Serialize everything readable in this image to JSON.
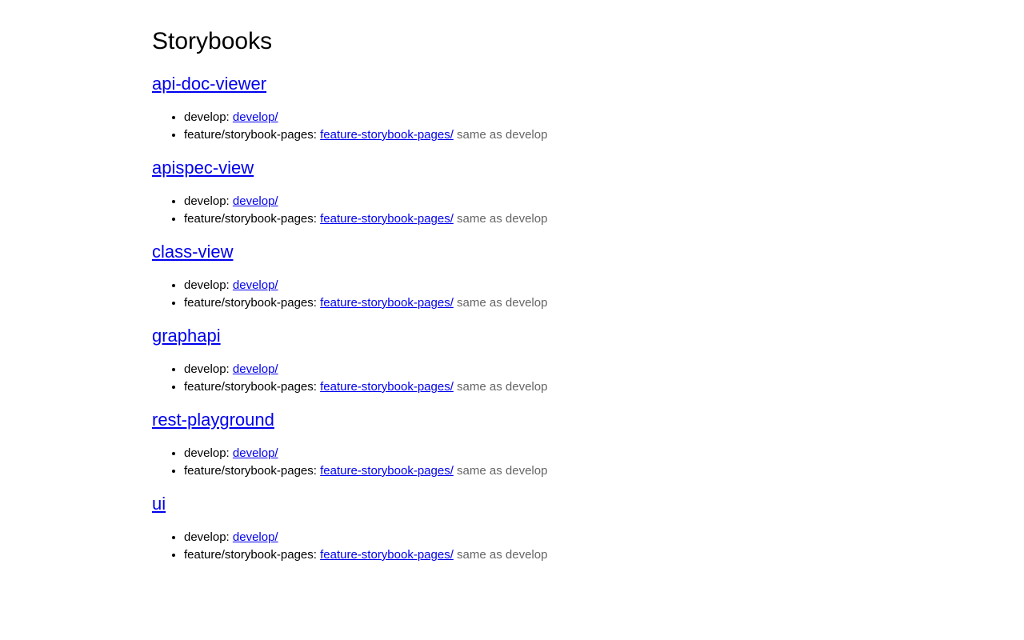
{
  "page": {
    "title": "Storybooks"
  },
  "sections": [
    {
      "name": "api-doc-viewer",
      "branches": [
        {
          "label": "develop:",
          "link": "develop/",
          "note": ""
        },
        {
          "label": "feature/storybook-pages:",
          "link": "feature-storybook-pages/",
          "note": "same as develop"
        }
      ]
    },
    {
      "name": "apispec-view",
      "branches": [
        {
          "label": "develop:",
          "link": "develop/",
          "note": ""
        },
        {
          "label": "feature/storybook-pages:",
          "link": "feature-storybook-pages/",
          "note": "same as develop"
        }
      ]
    },
    {
      "name": "class-view",
      "branches": [
        {
          "label": "develop:",
          "link": "develop/",
          "note": ""
        },
        {
          "label": "feature/storybook-pages:",
          "link": "feature-storybook-pages/",
          "note": "same as develop"
        }
      ]
    },
    {
      "name": "graphapi",
      "branches": [
        {
          "label": "develop:",
          "link": "develop/",
          "note": ""
        },
        {
          "label": "feature/storybook-pages:",
          "link": "feature-storybook-pages/",
          "note": "same as develop"
        }
      ]
    },
    {
      "name": "rest-playground",
      "branches": [
        {
          "label": "develop:",
          "link": "develop/",
          "note": ""
        },
        {
          "label": "feature/storybook-pages:",
          "link": "feature-storybook-pages/",
          "note": "same as develop"
        }
      ]
    },
    {
      "name": "ui",
      "branches": [
        {
          "label": "develop:",
          "link": "develop/",
          "note": ""
        },
        {
          "label": "feature/storybook-pages:",
          "link": "feature-storybook-pages/",
          "note": "same as develop"
        }
      ]
    }
  ],
  "colors": {
    "link": "#0000ee",
    "note": "#666666",
    "text": "#000000"
  }
}
